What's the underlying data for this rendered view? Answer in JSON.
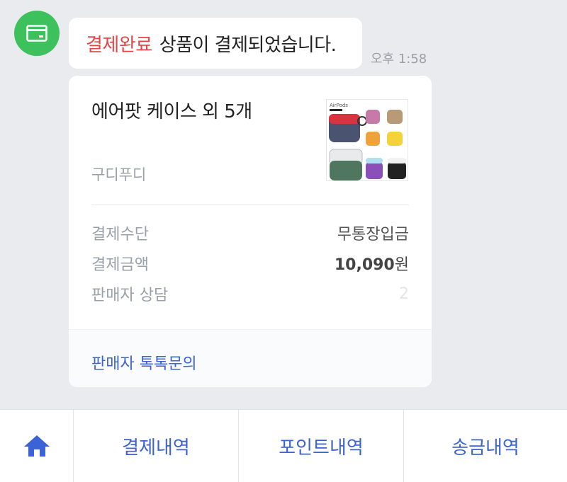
{
  "message": {
    "status_accent": "결제완료",
    "status_text": "상품이 결제되었습니다.",
    "time": "오후 1:58"
  },
  "card": {
    "title": "에어팟 케이스 외 5개",
    "seller": "구디푸디",
    "thumbnail_caption": "AirPods",
    "rows": [
      {
        "label": "결제수단",
        "value": "무통장입금"
      },
      {
        "label": "결제금액",
        "amount": "10,090",
        "unit": "원"
      },
      {
        "label": "판매자 상담",
        "value": "2"
      }
    ],
    "footer_link": "판매자 톡톡문의"
  },
  "bottom_nav": {
    "home_icon": "home-icon",
    "tabs": [
      "결제내역",
      "포인트내역",
      "송금내역"
    ]
  },
  "colors": {
    "accent_red": "#e64545",
    "link_blue": "#3c63d6",
    "avatar_green": "#3cc15d",
    "background": "#e9ebef"
  }
}
